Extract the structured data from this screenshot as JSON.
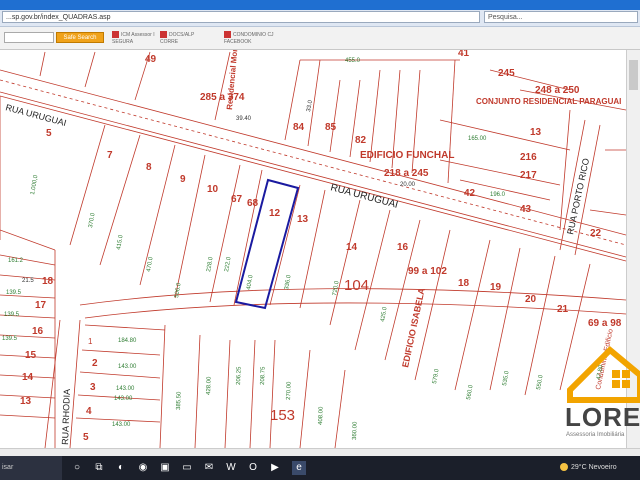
{
  "browser": {
    "url": "...sp.gov.br/index_QUADRAS.asp",
    "search_placeholder": "Pesquisa...",
    "quick_search_label": "Safe Search",
    "favorites": [
      {
        "label": "ICM Assessor I",
        "sub": "SEGURA"
      },
      {
        "label": "DOCS/ALP",
        "sub": "CORRE"
      },
      {
        "label": "CONDOMINIO CJ",
        "sub": "FACEBOOK"
      }
    ]
  },
  "map": {
    "street_labels": {
      "rua_uruguai_top": "RUA URUGUAI",
      "rua_uruguai_mid": "RUA URUGUAI",
      "rua_porto_rico": "RUA PORTO RICO",
      "rua_rhodia": "RUA RHODIA"
    },
    "building_labels": {
      "funchal": "EDIFICIO FUNCHAL",
      "isabela": "EDIFICIO ISABELA",
      "residencial": "Residencial Montevideo",
      "conjunto": "CONJUNTO RESIDENCIAL PARAGUAI",
      "cond_edificio": "Condominio Edificio"
    },
    "lot_numbers": {
      "n49": "49",
      "n285": "285 a 374",
      "n84": "84",
      "n85": "85",
      "n82": "82",
      "n41": "41",
      "n245": "245",
      "n248": "248 a 250",
      "n13a": "13",
      "n216": "216",
      "n217": "217",
      "n218": "218 a 245",
      "n42": "42",
      "n43": "43",
      "n5a": "5",
      "n7": "7",
      "n8": "8",
      "n9": "9",
      "n10a": "10",
      "n67": "67",
      "n68": "68",
      "n12": "12",
      "n13b": "13",
      "n14": "14",
      "n16": "16",
      "n99": "99 a 102",
      "n104": "104",
      "n18": "18",
      "n19": "19",
      "n20": "20",
      "n21": "21",
      "n69": "69 a 98",
      "n22": "22",
      "n18b": "18",
      "n17": "17",
      "n16b": "16",
      "n15": "15",
      "n14b": "14",
      "n13c": "13",
      "n5b": "5",
      "n4": "4",
      "n3": "3",
      "n2": "2",
      "n1": "1",
      "n153": "153"
    },
    "measures": {
      "m455": "455.0",
      "m330": "33.0",
      "m1000": "1.000,0",
      "m3700": "370.0",
      "m4150": "415.0",
      "m4700": "470.0",
      "m5060": "506.0",
      "m2280": "228.0",
      "m2220": "222.0",
      "m4040": "404.0",
      "m3360": "336.0",
      "m7200": "720.0",
      "m4250": "425.0",
      "m5790": "579.0",
      "m5600": "560.0",
      "m5350": "535.0",
      "m5500": "550.0",
      "m1848": "184.80",
      "m1430a": "143.00",
      "m1430b": "143.00",
      "m1430c": "143.00",
      "m1430d": "143.00",
      "m3850": "385.50",
      "m4280": "428.00",
      "m2062": "206.25",
      "m2087": "208.75",
      "m2700": "270.00",
      "m4080": "408.00",
      "m3600": "360.00",
      "m1612": "161.2",
      "m215": "21.5",
      "m1395a": "139.5",
      "m1395b": "139.5",
      "m1395c": "139.5",
      "m1650": "165.00",
      "m1960": "196.0",
      "m3940": "39.40",
      "m2000": "20.00",
      "m4780": "47.80"
    }
  },
  "logo": {
    "text": "LORE",
    "sub": "Assessoria Imobiliária"
  },
  "taskbar": {
    "search_text": "isar",
    "weather": "29°C  Nevoeiro"
  },
  "colors": {
    "accent": "#1f6fd1",
    "map_line": "#c0392b",
    "lot_text": "#c0392b",
    "selection": "#1a1aa0",
    "measure_text": "#2e7d32"
  }
}
